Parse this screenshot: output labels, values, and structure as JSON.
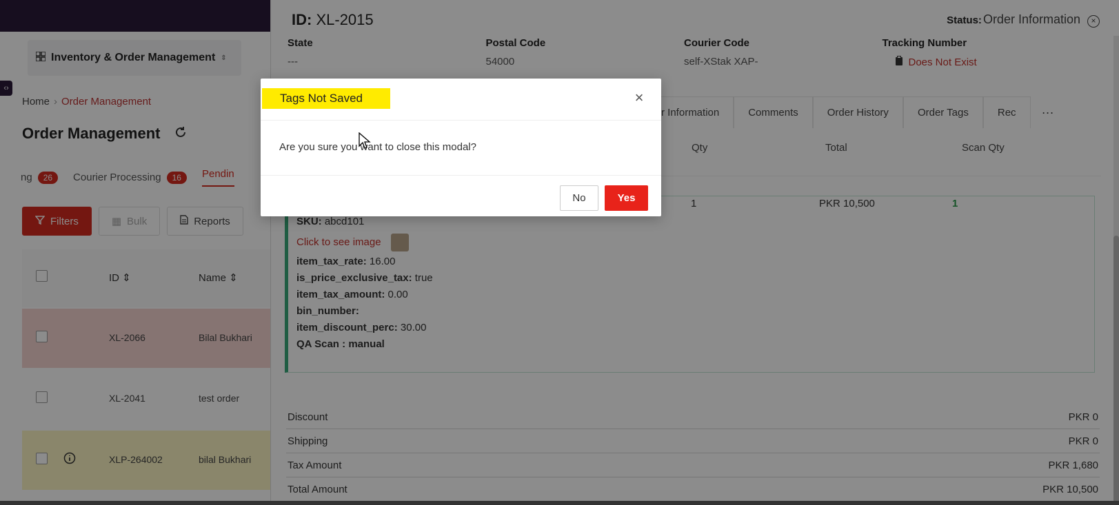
{
  "app": {
    "selector_label": "Inventory & Order Management",
    "sidebar_toggle_glyph": "‹›",
    "selector_chevron": "⌃⌄"
  },
  "breadcrumb": {
    "home": "Home",
    "separator": "›",
    "current": "Order Management"
  },
  "page": {
    "title": "Order Management"
  },
  "status_tabs": [
    {
      "label": "ng",
      "count": "26"
    },
    {
      "label": "Courier Processing",
      "count": "16"
    },
    {
      "label": "Pendin"
    }
  ],
  "toolbar": {
    "filters": "Filters",
    "bulk": "Bulk",
    "reports": "Reports"
  },
  "list": {
    "headers": {
      "id": "ID",
      "name": "Name"
    },
    "rows": [
      {
        "id": "XL-2066",
        "name": "Bilal Bukhari",
        "color": "#f4d3d0"
      },
      {
        "id": "XL-2041",
        "name": "test order",
        "color": "#ffffff"
      },
      {
        "id": "XLP-264002",
        "name": "bilal Bukhari",
        "color": "#fbf5c4",
        "info": true
      }
    ]
  },
  "drawer": {
    "id_label": "ID:",
    "id_value": "XL-2015",
    "status_label": "Status:",
    "status_value": "Order Information",
    "info": [
      {
        "label": "State",
        "value": "---"
      },
      {
        "label": "Postal Code",
        "value": "54000"
      },
      {
        "label": "Courier Code",
        "value": "self-XStak XAP-"
      },
      {
        "label": "Tracking Number",
        "value": "Does Not Exist"
      }
    ],
    "tabs": [
      "urier Information",
      "Comments",
      "Order History",
      "Order Tags",
      "Rec"
    ],
    "tabs_more": "···",
    "table_headers": {
      "qty": "Qty",
      "total": "Total",
      "scan_qty": "Scan Qty"
    },
    "item": {
      "qty": "1",
      "total": "PKR 10,500",
      "scan_qty": "1",
      "sku_label": "SKU:",
      "sku_value": "abcd101",
      "image_link": "Click to see image",
      "attrs": [
        {
          "label": "item_tax_rate:",
          "value": "16.00"
        },
        {
          "label": "is_price_exclusive_tax:",
          "value": "true"
        },
        {
          "label": "item_tax_amount:",
          "value": "0.00"
        },
        {
          "label": "bin_number:",
          "value": ""
        },
        {
          "label": "item_discount_perc:",
          "value": "30.00"
        },
        {
          "label": "QA Scan :",
          "value": "manual"
        }
      ]
    },
    "totals": [
      {
        "label": "Discount",
        "value": "PKR 0"
      },
      {
        "label": "Shipping",
        "value": "PKR 0"
      },
      {
        "label": "Tax Amount",
        "value": "PKR 1,680"
      },
      {
        "label": "Total Amount",
        "value": "PKR 10,500"
      }
    ]
  },
  "modal": {
    "title": "Tags Not Saved",
    "message": "Are you sure you want to close this modal?",
    "no_label": "No",
    "yes_label": "Yes",
    "close_glyph": "×",
    "title_highlight": "#ffeb00"
  },
  "colors": {
    "accent": "#d42b1f",
    "topbar": "#2a1b3a",
    "success": "#39a97a"
  }
}
